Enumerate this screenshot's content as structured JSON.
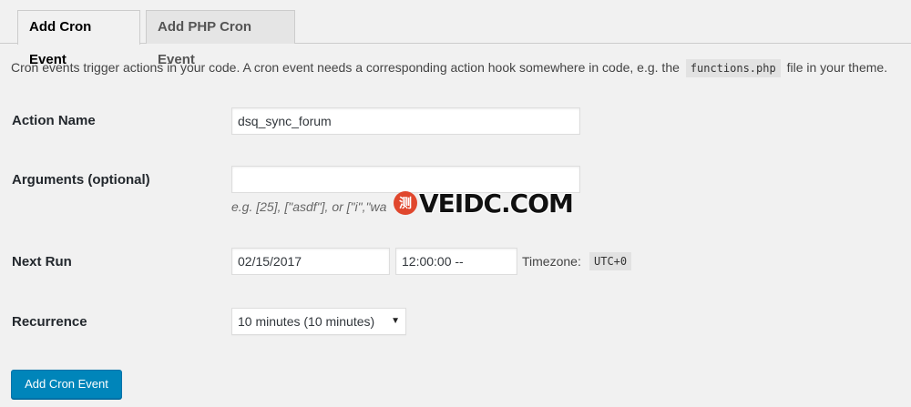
{
  "tabs": [
    {
      "label": "Add Cron Event",
      "active": true
    },
    {
      "label": "Add PHP Cron Event",
      "active": false
    }
  ],
  "intro": {
    "text_before": "Cron events trigger actions in your code. A cron event needs a corresponding action hook somewhere in code, e.g. the",
    "code": "functions.php",
    "text_after": "file in your theme."
  },
  "form": {
    "action_name": {
      "label": "Action Name",
      "value": "dsq_sync_forum"
    },
    "arguments": {
      "label": "Arguments (optional)",
      "value": "",
      "hint": "e.g. [25], [\"asdf\"], or [\"i\",\"wa"
    },
    "next_run": {
      "label": "Next Run",
      "date": "02/15/2017",
      "time": "12:00:00 --",
      "timezone_label": "Timezone:",
      "timezone_value": "UTC+0"
    },
    "recurrence": {
      "label": "Recurrence",
      "selected": "10 minutes (10 minutes)",
      "arrow": "▼"
    },
    "submit_label": "Add Cron Event"
  },
  "watermark": {
    "badge": "测",
    "text": "VEIDC.COM"
  }
}
